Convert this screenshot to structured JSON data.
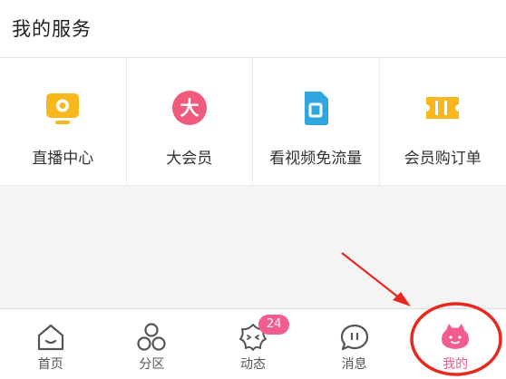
{
  "header": {
    "title": "我的服务"
  },
  "services": [
    {
      "label": "直播中心",
      "icon": "live-tv-icon",
      "color": "#f8b81d"
    },
    {
      "label": "大会员",
      "icon": "vip-da-icon",
      "color": "#ef5a7d",
      "glyph": "大"
    },
    {
      "label": "看视频免流量",
      "icon": "sim-card-icon",
      "color": "#2ea7e0"
    },
    {
      "label": "会员购订单",
      "icon": "ticket-icon",
      "color": "#f8b81d"
    }
  ],
  "tabbar": {
    "items": [
      {
        "label": "首页",
        "icon": "home-icon",
        "active": false
      },
      {
        "label": "分区",
        "icon": "category-circles-icon",
        "active": false
      },
      {
        "label": "动态",
        "icon": "dynamic-face-icon",
        "active": false,
        "badge": "24"
      },
      {
        "label": "消息",
        "icon": "message-bubble-icon",
        "active": false
      },
      {
        "label": "我的",
        "icon": "profile-face-icon",
        "active": true
      }
    ],
    "active_color": "#f25d8e",
    "badge_color": "#f25d8e"
  },
  "annotation": {
    "color": "#e8281e"
  }
}
